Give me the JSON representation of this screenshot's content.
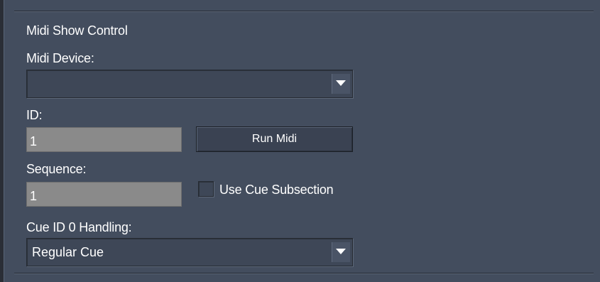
{
  "section": {
    "title": "Midi Show Control"
  },
  "midi_device": {
    "label": "Midi Device:",
    "value": ""
  },
  "id_field": {
    "label": "ID:",
    "value": "1"
  },
  "run_midi_button": {
    "label": "Run Midi"
  },
  "sequence_field": {
    "label": "Sequence:",
    "value": "1"
  },
  "use_cue_subsection": {
    "label": "Use Cue Subsection",
    "checked": false
  },
  "cue_id0_handling": {
    "label": "Cue ID 0 Handling:",
    "value": "Regular Cue"
  },
  "colors": {
    "background": "#434d5e",
    "input_background": "#8a8a8a",
    "text": "#ffffff"
  }
}
